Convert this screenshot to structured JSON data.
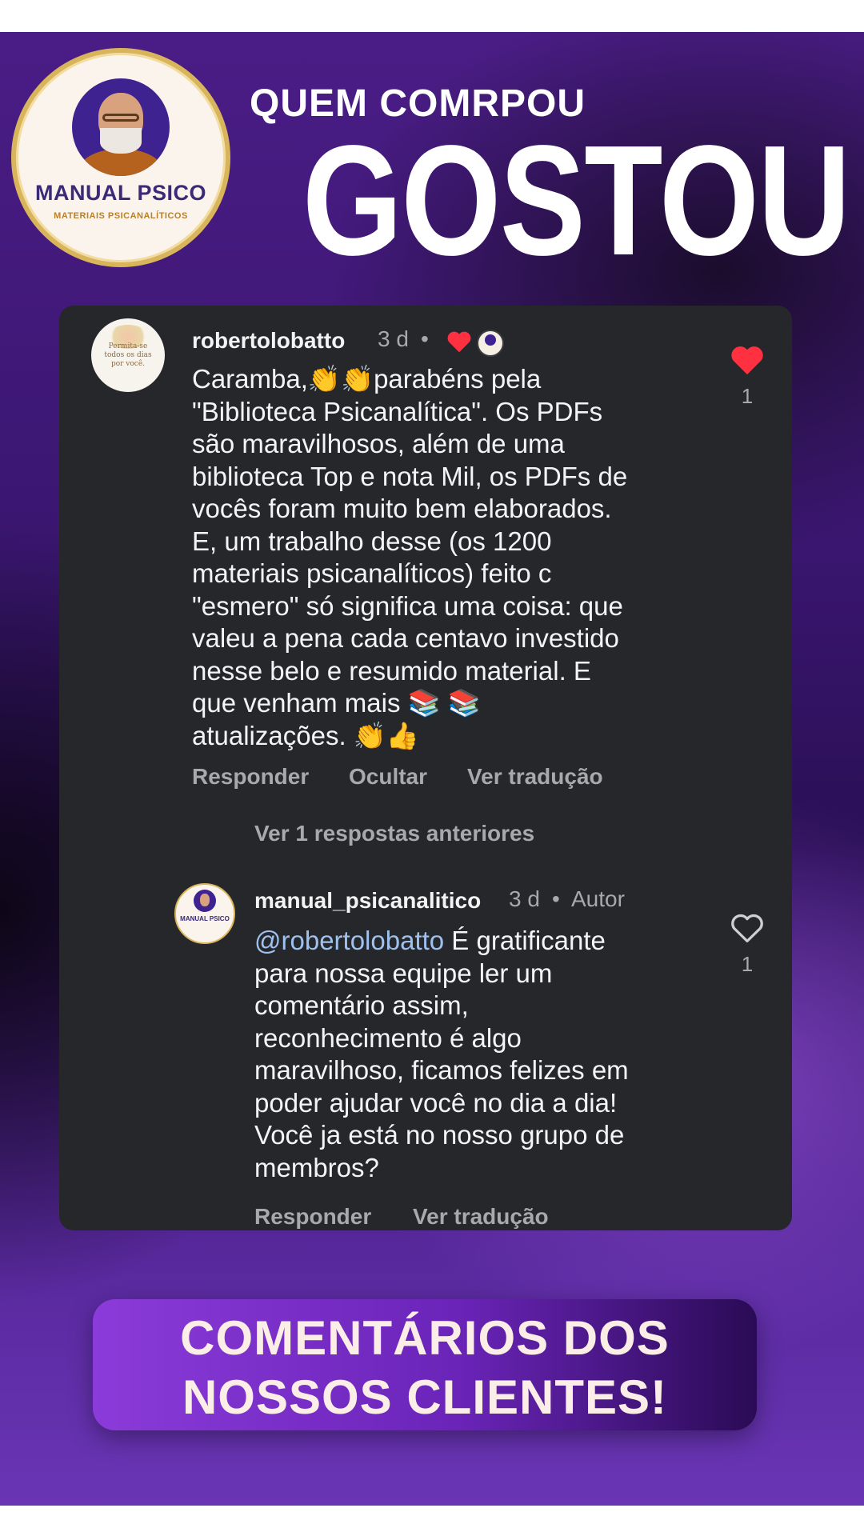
{
  "logo": {
    "brand": "MANUAL PSICO",
    "subtitle": "MATERIAIS PSICANALÍTICOS",
    "icon": "freud-portrait-icon"
  },
  "headline": {
    "line1": "QUEM COMRPOU",
    "line2": "GOSTOU"
  },
  "comment": {
    "avatar_text": "Permita-se todos os dias por você.",
    "username": "robertolobatto",
    "time": "3 d",
    "separator": "•",
    "text": "Caramba,👏👏parabéns pela\n\"Biblioteca Psicanalítica\". Os PDFs\nsão maravilhosos, além de uma\nbiblioteca Top e nota Mil, os PDFs de\nvocês foram muito bem elaborados.\nE, um trabalho desse (os 1200\nmateriais psicanalíticos) feito c\n\"esmero\" só significa uma coisa: que\nvaleu a pena cada centavo investido\nnesse belo e resumido material. E\nque venham mais 📚 📚\natualizações. 👏👍",
    "like_count": "1",
    "actions": [
      "Responder",
      "Ocultar",
      "Ver tradução"
    ],
    "view_replies": "Ver 1 respostas anteriores"
  },
  "reply": {
    "avatar_text": "MANUAL PSICO",
    "username": "manual_psicanalitico",
    "time": "3 d",
    "separator": "•",
    "author_badge": "Autor",
    "mention": "@robertolobatto",
    "text": " É gratificante\npara nossa equipe ler um\ncomentário assim,\nreconhecimento é algo\nmaravilhoso, ficamos felizes em\npoder ajudar você no dia a dia!\nVocê ja está no nosso grupo de\nmembros?",
    "like_count": "1",
    "actions": [
      "Responder",
      "Ver tradução"
    ]
  },
  "banner": {
    "line1": "COMENTÁRIOS DOS",
    "line2": "NOSSOS CLIENTES!"
  },
  "colors": {
    "card_bg": "#25272b",
    "liked_heart": "#ff3040",
    "mention": "#9fc1ee",
    "muted_text": "#a8a8ad"
  }
}
